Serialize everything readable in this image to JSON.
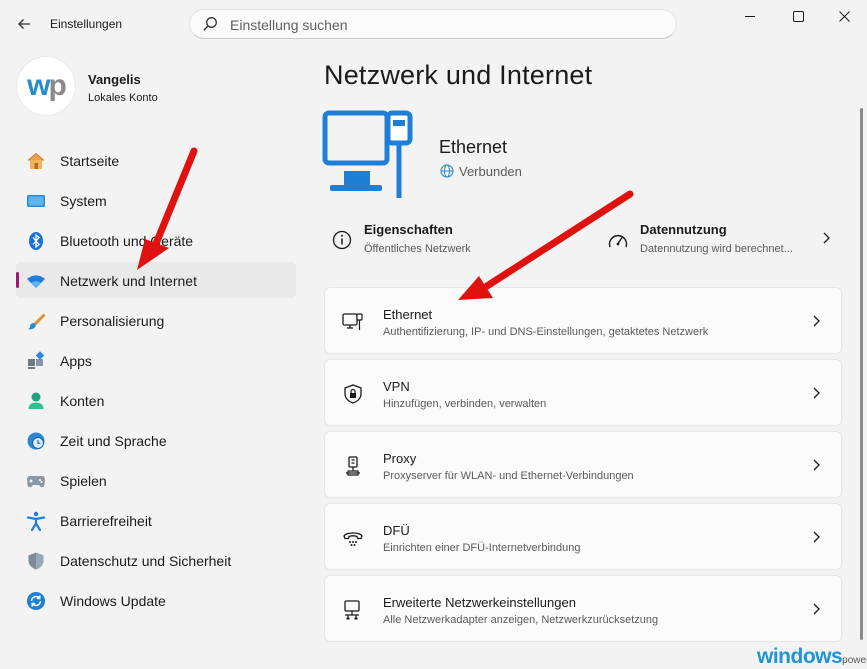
{
  "titlebar": {
    "app_title": "Einstellungen",
    "back_icon": "back-arrow-icon",
    "window_controls": [
      "minimize-icon",
      "maximize-icon",
      "close-icon"
    ]
  },
  "search": {
    "placeholder": "Einstellung suchen",
    "value": ""
  },
  "profile": {
    "avatar_text_a": "w",
    "avatar_text_b": "p",
    "name": "Vangelis",
    "account_type": "Lokales Konto"
  },
  "sidebar": {
    "items": [
      {
        "label": "Startseite",
        "icon": "home-icon"
      },
      {
        "label": "System",
        "icon": "monitor-icon"
      },
      {
        "label": "Bluetooth und Geräte",
        "icon": "bluetooth-icon"
      },
      {
        "label": "Netzwerk und Internet",
        "icon": "wifi-icon",
        "selected": true
      },
      {
        "label": "Personalisierung",
        "icon": "paintbrush-icon"
      },
      {
        "label": "Apps",
        "icon": "apps-icon"
      },
      {
        "label": "Konten",
        "icon": "person-icon"
      },
      {
        "label": "Zeit und Sprache",
        "icon": "clock-globe-icon"
      },
      {
        "label": "Spielen",
        "icon": "gamepad-icon"
      },
      {
        "label": "Barrierefreiheit",
        "icon": "accessibility-icon"
      },
      {
        "label": "Datenschutz und Sicherheit",
        "icon": "shield-icon"
      },
      {
        "label": "Windows Update",
        "icon": "update-icon"
      }
    ]
  },
  "main": {
    "title": "Netzwerk und Internet",
    "hero": {
      "name": "Ethernet",
      "status": "Verbunden",
      "icon": "ethernet-monitor-icon"
    },
    "quick": [
      {
        "title": "Eigenschaften",
        "subtitle": "Öffentliches Netzwerk",
        "icon": "info-icon"
      },
      {
        "title": "Datennutzung",
        "subtitle": "Datennutzung wird berechnet...",
        "icon": "data-usage-icon"
      }
    ],
    "cards": [
      {
        "title": "Ethernet",
        "subtitle": "Authentifizierung, IP- und DNS-Einstellungen, getaktetes Netzwerk",
        "icon": "ethernet-icon"
      },
      {
        "title": "VPN",
        "subtitle": "Hinzufügen, verbinden, verwalten",
        "icon": "vpn-shield-icon"
      },
      {
        "title": "Proxy",
        "subtitle": "Proxyserver für WLAN- und Ethernet-Verbindungen",
        "icon": "proxy-icon"
      },
      {
        "title": "DFÜ",
        "subtitle": "Einrichten einer DFÜ-Internetverbindung",
        "icon": "dialup-icon"
      },
      {
        "title": "Erweiterte Netzwerkeinstellungen",
        "subtitle": "Alle Netzwerkadapter anzeigen, Netzwerkzurücksetzung",
        "icon": "advanced-network-icon"
      }
    ]
  },
  "watermark": {
    "brand": "windows",
    "suffix": "power"
  },
  "colors": {
    "accent": "#0f6cbd",
    "selection_bar": "#9b1b6f",
    "annotation_arrow": "#e0120f"
  }
}
